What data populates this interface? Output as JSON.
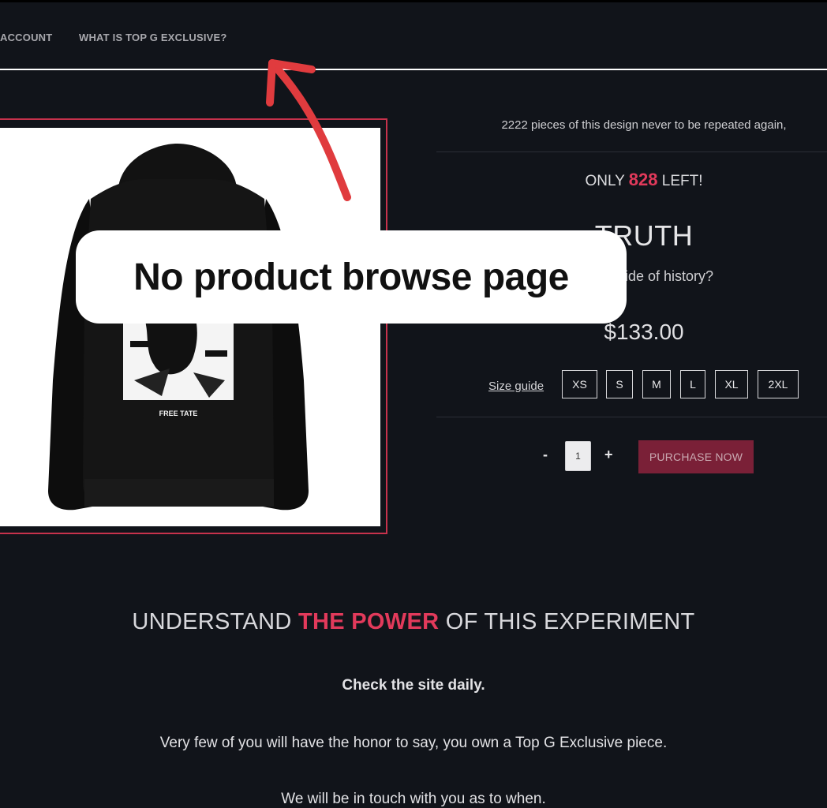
{
  "nav": {
    "account_label": "ACCOUNT",
    "about_label": "WHAT IS TOP G EXCLUSIVE?"
  },
  "product": {
    "limited_text": "2222 pieces of this design never to be repeated again,",
    "stock_prefix": "ONLY",
    "stock_count": "828",
    "stock_suffix": "LEFT!",
    "title": "TRUTH",
    "subtitle": "e right side of history?",
    "price": "$133.00",
    "size_guide_label": "Size guide",
    "sizes": [
      "XS",
      "S",
      "M",
      "L",
      "XL",
      "2XL"
    ],
    "quantity": "1",
    "qty_minus": "-",
    "qty_plus": "+",
    "purchase_label": "PURCHASE NOW",
    "image_print_text": "FREE TATE"
  },
  "section": {
    "heading_pre": "UNDERSTAND",
    "heading_accent": "THE POWER",
    "heading_post": "OF THIS EXPERIMENT",
    "paragraphs": [
      "Check the site daily.",
      "Very few of you will have the honor to say, you own a Top G Exclusive piece.",
      "We will be in touch with you as to when."
    ]
  },
  "annotation": {
    "callout_text": "No product browse page"
  },
  "colors": {
    "background": "#11141a",
    "accent_red": "#e23a5b",
    "frame_red": "#c7324c",
    "purchase_button": "#7a2037",
    "arrow_red": "#e03b3e"
  }
}
